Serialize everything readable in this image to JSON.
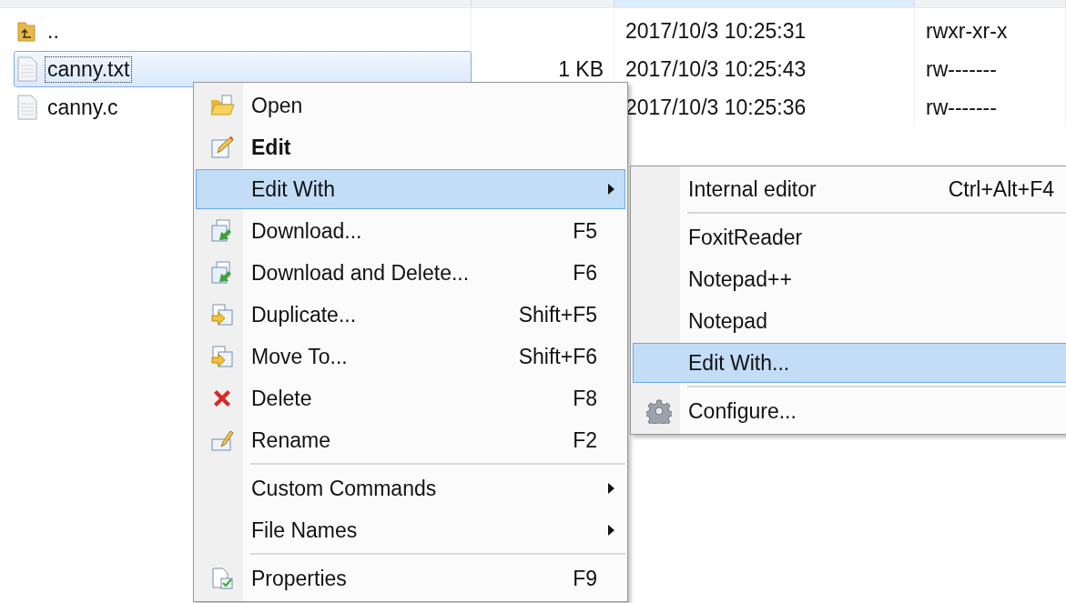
{
  "files": [
    {
      "name": "..",
      "kind": "parent",
      "modified": "2017/10/3 10:25:31",
      "permissions": "rwxr-xr-x",
      "selected": false,
      "focused": false
    },
    {
      "name": "canny.txt",
      "kind": "file",
      "size": "1 KB",
      "modified": "2017/10/3 10:25:43",
      "permissions": "rw-------",
      "selected": true,
      "focused": true
    },
    {
      "name": "canny.c",
      "kind": "file",
      "modified": "2017/10/3 10:25:36",
      "permissions": "rw-------",
      "selected": false,
      "focused": false
    }
  ],
  "context_menu": {
    "items": [
      {
        "kind": "item",
        "label": "Open",
        "default": false,
        "submenu": false,
        "selected": false
      },
      {
        "kind": "item",
        "label": "Edit",
        "default": true,
        "submenu": false,
        "selected": false
      },
      {
        "kind": "item",
        "label": "Edit With",
        "default": false,
        "submenu": true,
        "selected": true
      },
      {
        "kind": "item",
        "label": "Download...",
        "shortcut": "F5",
        "default": false,
        "submenu": false,
        "selected": false
      },
      {
        "kind": "item",
        "label": "Download and Delete...",
        "shortcut": "F6",
        "default": false,
        "submenu": false,
        "selected": false
      },
      {
        "kind": "item",
        "label": "Duplicate...",
        "shortcut": "Shift+F5",
        "default": false,
        "submenu": false,
        "selected": false
      },
      {
        "kind": "item",
        "label": "Move To...",
        "shortcut": "Shift+F6",
        "default": false,
        "submenu": false,
        "selected": false
      },
      {
        "kind": "item",
        "label": "Delete",
        "shortcut": "F8",
        "default": false,
        "submenu": false,
        "selected": false
      },
      {
        "kind": "item",
        "label": "Rename",
        "shortcut": "F2",
        "default": false,
        "submenu": false,
        "selected": false
      },
      {
        "kind": "separator"
      },
      {
        "kind": "item",
        "label": "Custom Commands",
        "default": false,
        "submenu": true,
        "selected": false
      },
      {
        "kind": "item",
        "label": "File Names",
        "default": false,
        "submenu": true,
        "selected": false
      },
      {
        "kind": "separator"
      },
      {
        "kind": "item",
        "label": "Properties",
        "shortcut": "F9",
        "default": false,
        "submenu": false,
        "selected": false
      }
    ]
  },
  "submenu": {
    "items": [
      {
        "kind": "item",
        "label": "Internal editor",
        "shortcut": "Ctrl+Alt+F4",
        "default": false,
        "submenu": false,
        "selected": false
      },
      {
        "kind": "separator"
      },
      {
        "kind": "item",
        "label": "FoxitReader",
        "default": false,
        "submenu": false,
        "selected": false
      },
      {
        "kind": "item",
        "label": "Notepad++",
        "default": false,
        "submenu": false,
        "selected": false
      },
      {
        "kind": "item",
        "label": "Notepad",
        "default": false,
        "submenu": false,
        "selected": false
      },
      {
        "kind": "item",
        "label": "Edit With...",
        "default": false,
        "submenu": false,
        "selected": true
      },
      {
        "kind": "separator"
      },
      {
        "kind": "item",
        "label": "Configure...",
        "default": false,
        "submenu": false,
        "selected": false
      }
    ]
  }
}
